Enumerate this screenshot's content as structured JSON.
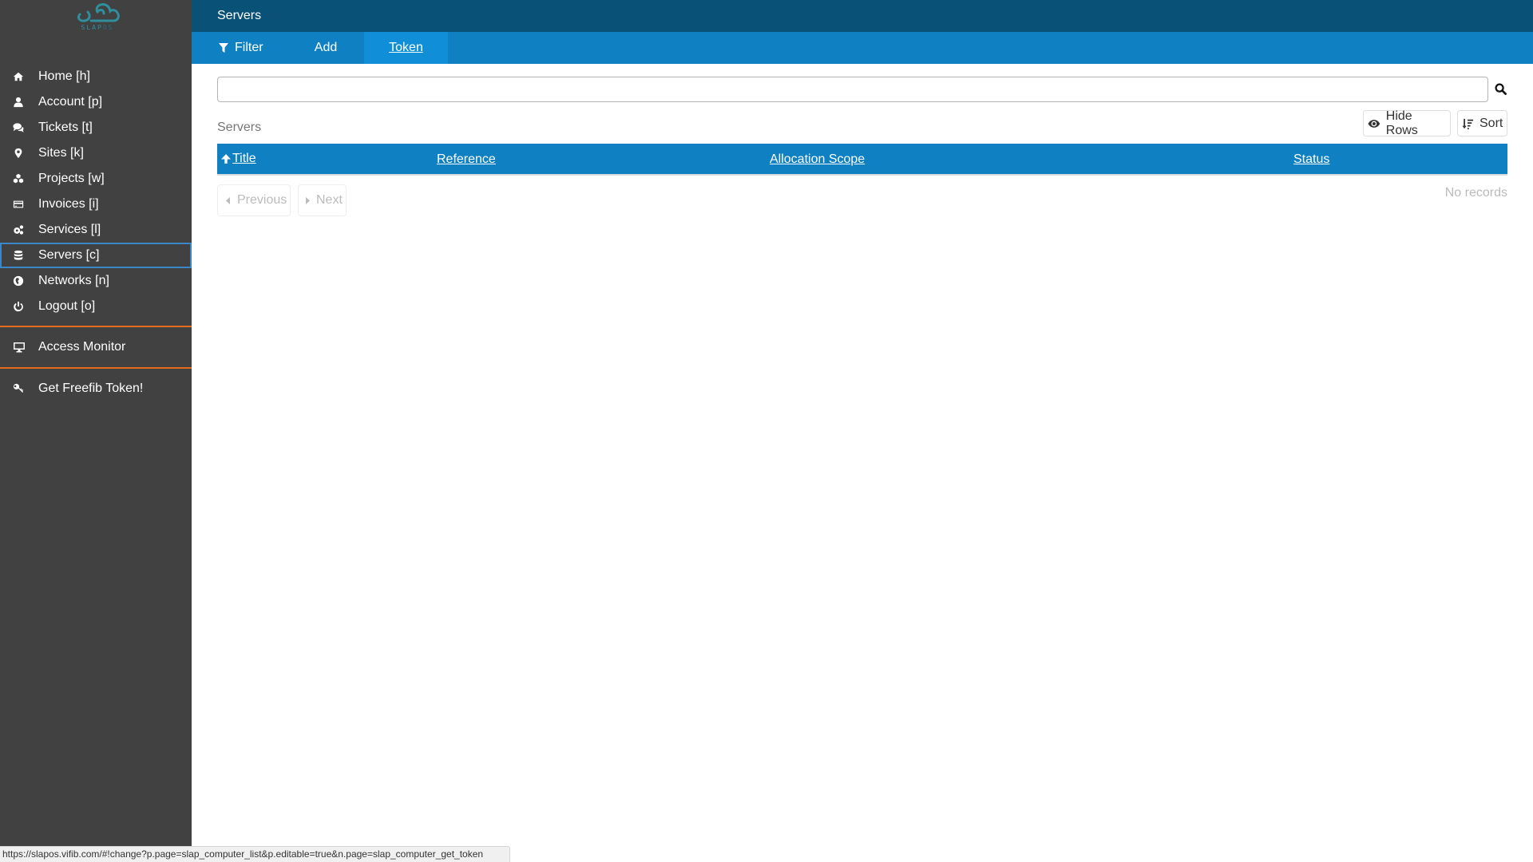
{
  "logo": {
    "brand_a": "SLAP",
    "brand_b": "OS"
  },
  "sidebar": {
    "items": [
      {
        "label": "Home [h]",
        "icon": "home-icon"
      },
      {
        "label": "Account [p]",
        "icon": "user-icon"
      },
      {
        "label": "Tickets [t]",
        "icon": "comments-icon"
      },
      {
        "label": "Sites [k]",
        "icon": "map-marker-icon"
      },
      {
        "label": "Projects [w]",
        "icon": "cubes-icon"
      },
      {
        "label": "Invoices [i]",
        "icon": "credit-card-icon"
      },
      {
        "label": "Services [l]",
        "icon": "cogs-icon"
      },
      {
        "label": "Servers [c]",
        "icon": "database-icon",
        "active": true
      },
      {
        "label": "Networks [n]",
        "icon": "globe-icon"
      },
      {
        "label": "Logout [o]",
        "icon": "power-icon"
      }
    ],
    "extra": [
      {
        "label": "Access Monitor",
        "icon": "desktop-icon"
      },
      {
        "label": "Get Freefib Token!",
        "icon": "key-icon"
      }
    ],
    "separator_color": "#e36a1b",
    "active_border_color": "#3a87c8"
  },
  "header": {
    "title": "Servers"
  },
  "tabs": [
    {
      "label": "Filter",
      "icon": "filter-icon"
    },
    {
      "label": "Add"
    },
    {
      "label": "Token",
      "active": true
    }
  ],
  "search": {
    "value": "",
    "placeholder": "",
    "button_icon": "search-icon"
  },
  "list": {
    "title": "Servers",
    "hide_rows_label": "Hide Rows",
    "sort_label": "Sort",
    "columns": [
      "Title",
      "Reference",
      "Allocation Scope",
      "Status"
    ],
    "sort_column": "Title",
    "sort_direction": "ascending",
    "rows": [],
    "empty_text": "No records",
    "previous_label": "Previous",
    "next_label": "Next"
  },
  "status_bar": {
    "url": "https://slapos.vifib.com/#!change?p.page=slap_computer_list&p.editable=true&n.page=slap_computer_get_token"
  },
  "colors": {
    "sidebar_bg": "#414141",
    "header_bg": "#0a5178",
    "tabs_bg": "#0f80c1",
    "active_tab_bg": "#108fd8",
    "table_header_bg": "#0f80c1"
  }
}
